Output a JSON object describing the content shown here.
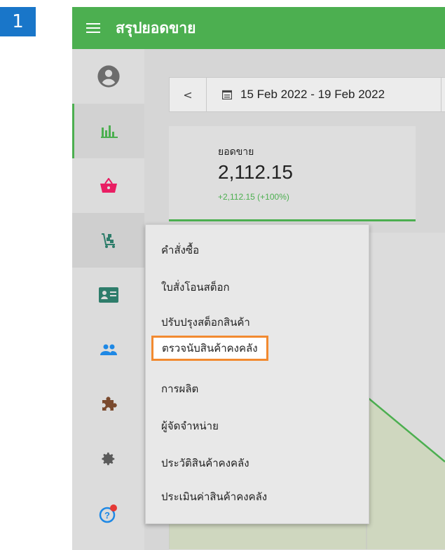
{
  "step_number": "1",
  "header": {
    "title": "สรุปยอดขาย"
  },
  "sidebar": {
    "items": [
      {
        "icon": "account-circle-icon"
      },
      {
        "icon": "bar-chart-icon",
        "active": true
      },
      {
        "icon": "shopping-basket-icon"
      },
      {
        "icon": "warehouse-cart-icon"
      },
      {
        "icon": "contact-card-icon"
      },
      {
        "icon": "people-icon"
      },
      {
        "icon": "puzzle-icon"
      },
      {
        "icon": "gear-icon"
      },
      {
        "icon": "help-icon"
      }
    ]
  },
  "datebar": {
    "prev_symbol": "<",
    "range": "15 Feb 2022 - 19 Feb 2022"
  },
  "stat": {
    "label": "ยอดขาย",
    "value": "2,112.15",
    "change": "+2,112.15 (+100%)"
  },
  "popup_menu": {
    "items": [
      {
        "label": "คำสั่งซื้อ"
      },
      {
        "label": "ใบสั่งโอนสต็อก"
      },
      {
        "label": "ปรับปรุงสต็อกสินค้า"
      },
      {
        "label": "ตรวจนับสินค้าคงคลัง",
        "highlighted": true
      },
      {
        "label": "การผลิต"
      },
      {
        "label": "ผู้จัดจำหน่าย"
      },
      {
        "label": "ประวัติสินค้าคงคลัง"
      },
      {
        "label": "ประเมินค่าสินค้าคงคลัง"
      }
    ]
  },
  "colors": {
    "brand_green": "#4caf50",
    "step_blue": "#1976c9",
    "highlight_orange": "#f28a30",
    "basket_pink": "#e91e63",
    "help_red": "#e53935",
    "icon_teal": "#2e7d6b",
    "icon_blue": "#1e88e5"
  }
}
